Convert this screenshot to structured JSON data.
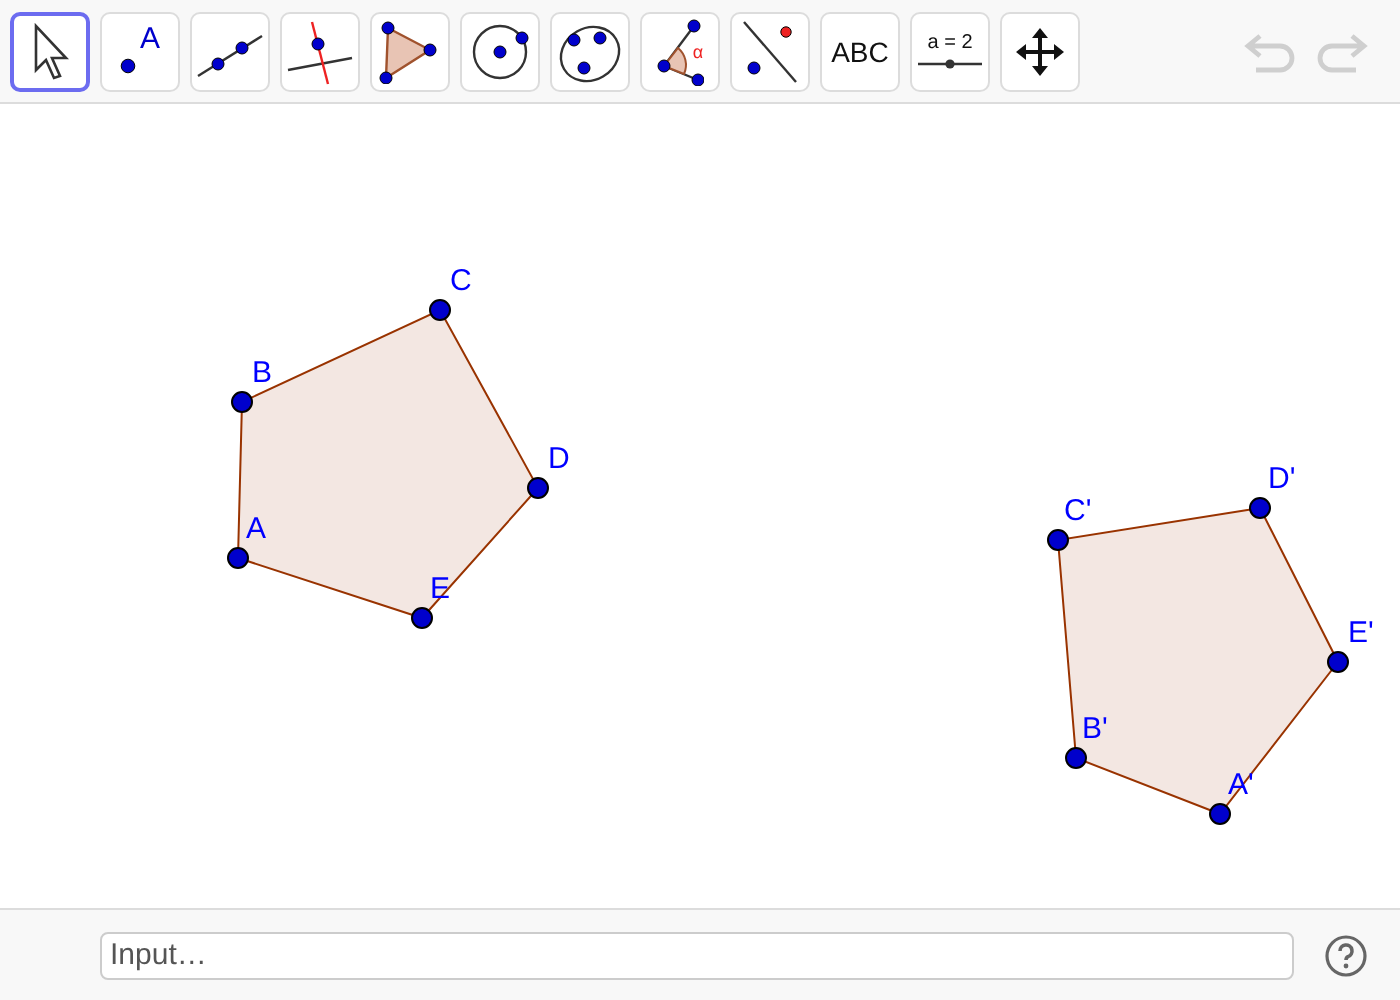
{
  "toolbar": {
    "tools": [
      {
        "kind": "move",
        "selected": true
      },
      {
        "kind": "point",
        "label": "A",
        "selected": false
      },
      {
        "kind": "line",
        "selected": false
      },
      {
        "kind": "perpendicular",
        "selected": false
      },
      {
        "kind": "polygon",
        "selected": false
      },
      {
        "kind": "circle",
        "selected": false
      },
      {
        "kind": "conic",
        "selected": false
      },
      {
        "kind": "angle",
        "label": "α",
        "selected": false
      },
      {
        "kind": "reflect",
        "selected": false
      },
      {
        "kind": "text",
        "label": "ABC",
        "selected": false
      },
      {
        "kind": "slider",
        "label": "a = 2",
        "selected": false
      },
      {
        "kind": "pan",
        "selected": false
      }
    ],
    "undo": {
      "disabled": true
    },
    "redo": {
      "disabled": true
    }
  },
  "canvas": {
    "polygons": [
      {
        "vertices": [
          {
            "label": "A"
          },
          {
            "label": "B"
          },
          {
            "label": "C"
          },
          {
            "label": "D"
          },
          {
            "label": "E"
          }
        ]
      },
      {
        "vertices": [
          {
            "label": "A'"
          },
          {
            "label": "B'"
          },
          {
            "label": "C'"
          },
          {
            "label": "D'"
          },
          {
            "label": "E'"
          }
        ]
      }
    ]
  },
  "input_bar": {
    "placeholder": "Input…"
  }
}
